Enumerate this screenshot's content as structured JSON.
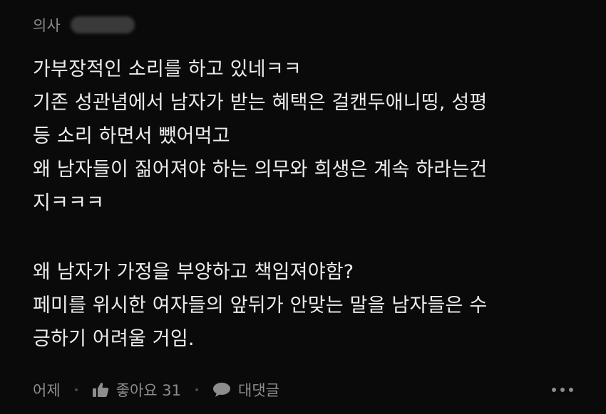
{
  "comment": {
    "author": "의사",
    "paragraphs": [
      {
        "lines": [
          "가부장적인 소리를 하고 있네ㅋㅋ",
          "기존 성관념에서 남자가 받는 혜택은 걸캔두애니띵, 성평",
          "등 소리 하면서 뺐어먹고",
          "왜 남자들이 짊어져야 하는 의무와 희생은 계속 하라는건",
          "지ㅋㅋㅋ"
        ]
      },
      {
        "lines": [
          "왜 남자가 가정을 부양하고 책임져야함?",
          "페미를 위시한 여자들의 앞뒤가 안맞는 말을 남자들은 수",
          "긍하기 어려울 거임."
        ]
      }
    ],
    "footer": {
      "time": "어제",
      "like_label": "좋아요 31",
      "reply_label": "대댓글"
    },
    "icons": {
      "like": "thumbs-up-icon",
      "reply": "speech-bubble-icon",
      "more": "more-icon"
    }
  },
  "colors": {
    "background": "#0a0a0a",
    "text": "#ececec",
    "muted": "#8d8d8d"
  }
}
